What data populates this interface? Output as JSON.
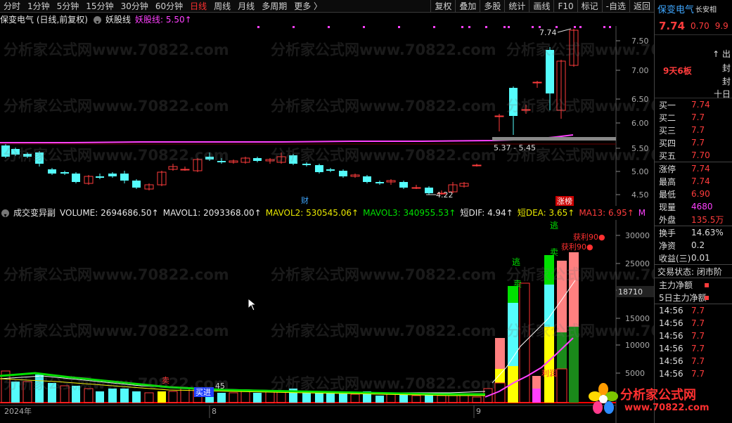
{
  "toolbar": {
    "periods": [
      "分时",
      "1分钟",
      "5分钟",
      "15分钟",
      "30分钟",
      "60分钟",
      "日线",
      "周线",
      "月线",
      "多周期",
      "更多 〉"
    ],
    "active_index": 6,
    "actions": [
      "复权",
      "叠加",
      "多股",
      "统计",
      "画线",
      "F10",
      "标记",
      "-自选",
      "返回"
    ]
  },
  "main_pane": {
    "stock_title": "保变电气 (日线,前复权)",
    "indicator": "妖股线",
    "indicator_value": "妖股线: 5.50↑",
    "y_ticks": [
      "7.50",
      "7.00",
      "6.50",
      "6.00",
      "5.50",
      "5.00",
      "4.50"
    ],
    "labels": {
      "high": "7.74",
      "low": "4.22",
      "range": "5.37 - 5.45",
      "cai": "财",
      "zhangting": "涨榜"
    }
  },
  "volume_pane": {
    "title": "成交变异副",
    "volume": "VOLUME: 2694686.50↑",
    "mavol1": "MAVOL1: 2093368.00↑",
    "mavol2": "MAVOL2: 530545.06↑",
    "mavol3": "MAVOL3: 340955.53↑",
    "dif": "短DIF: 4.94↑",
    "dea": "短DEA: 3.65↑",
    "ma13": "MA13: 6.95↑",
    "m": "M",
    "y_ticks": [
      "30000",
      "25000",
      "20000",
      "15000",
      "10000",
      "5000"
    ],
    "marker": "18710",
    "annotations": {
      "tao1": "逃",
      "mai1": "卖",
      "tao2": "逃",
      "mai2": "卖",
      "profit1": "获利90●",
      "profit2": "获利90●",
      "mai_left": "卖",
      "mai_bot": "买进",
      "li": "利润",
      "m45": "45"
    },
    "dates": [
      "2024年",
      "8",
      "9"
    ]
  },
  "right_panel": {
    "name": "保变电气",
    "sub": "长安相",
    "price": "7.74",
    "change": "0.70",
    "pct": "9.9",
    "tags": [
      "↑ 出",
      "封",
      "封",
      "十日"
    ],
    "board": "9天6板",
    "orders": [
      {
        "label": "买一",
        "value": "7.74"
      },
      {
        "label": "买二",
        "value": "7.7"
      },
      {
        "label": "买三",
        "value": "7.7"
      },
      {
        "label": "买四",
        "value": "7.7"
      },
      {
        "label": "买五",
        "value": "7.70"
      }
    ],
    "stats": [
      {
        "label": "涨停",
        "value": "7.74"
      },
      {
        "label": "最高",
        "value": "7.74"
      },
      {
        "label": "最低",
        "value": "6.90"
      },
      {
        "label": "现量",
        "value": "4680"
      },
      {
        "label": "外盘",
        "value": "135.5万"
      }
    ],
    "stats2": [
      {
        "label": "换手",
        "value": "14.63%"
      },
      {
        "label": "净资",
        "value": "0.2"
      },
      {
        "label": "收益(三)",
        "value": "0.01"
      }
    ],
    "status": "交易状态: 闭市阶",
    "flows": [
      {
        "label": "主力净额",
        "value": "▪"
      },
      {
        "label": "5日主力净额",
        "value": "▪"
      }
    ],
    "trades": [
      {
        "time": "14:56",
        "value": "7.7"
      },
      {
        "time": "14:56",
        "value": "7.7"
      },
      {
        "time": "14:56",
        "value": "7.7"
      },
      {
        "time": "14:56",
        "value": "7.7"
      },
      {
        "time": "14:56",
        "value": "7.7"
      },
      {
        "time": "14:56",
        "value": "7.7"
      }
    ]
  },
  "watermark": "分析家公式网www.70822.com",
  "logo": {
    "text": "分析家公式网",
    "url": "www.70822.com"
  },
  "colors": {
    "up": "#ff3c3c",
    "down": "#54fcfc",
    "ma": "#ff40ff",
    "vol_green": "#00e000",
    "vol_yellow": "#ffff00"
  }
}
